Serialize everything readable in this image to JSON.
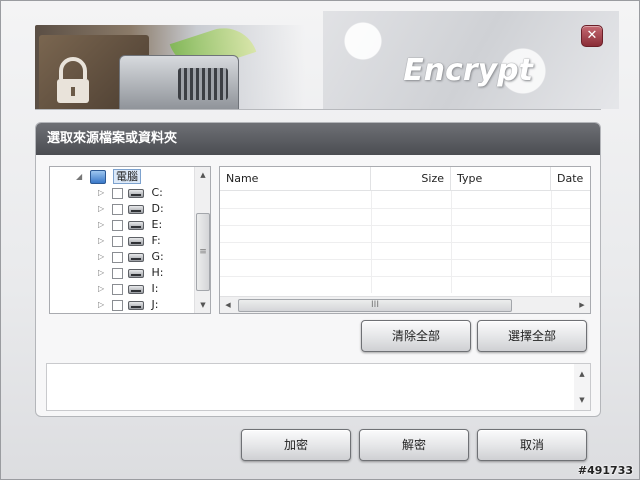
{
  "app": {
    "title": "Encrypt"
  },
  "panel": {
    "title": "選取來源檔案或資料夾"
  },
  "tree": {
    "root": {
      "label": "電腦",
      "icon": "computer-icon"
    },
    "drives": [
      {
        "label": "C:",
        "icon": "system-drive-icon"
      },
      {
        "label": "D:",
        "icon": "optical-drive-icon"
      },
      {
        "label": "E:",
        "icon": "hard-drive-icon"
      },
      {
        "label": "F:",
        "icon": "hard-drive-icon"
      },
      {
        "label": "G:",
        "icon": "hard-drive-icon"
      },
      {
        "label": "H:",
        "icon": "hard-drive-icon"
      },
      {
        "label": "I:",
        "icon": "hard-drive-icon"
      },
      {
        "label": "J:",
        "icon": "hard-drive-icon"
      }
    ]
  },
  "filelist": {
    "columns": [
      "Name",
      "Size",
      "Type",
      "Date"
    ],
    "hscroll_grip": "III",
    "vscroll_grip": "≡"
  },
  "actions": {
    "clear_all": "清除全部",
    "select_all": "選擇全部"
  },
  "footer": {
    "encrypt": "加密",
    "decrypt": "解密",
    "cancel": "取消"
  },
  "watermark": "#491733",
  "colors": {
    "title_bar": "#5a5c61",
    "close_button": "#a3424c"
  }
}
